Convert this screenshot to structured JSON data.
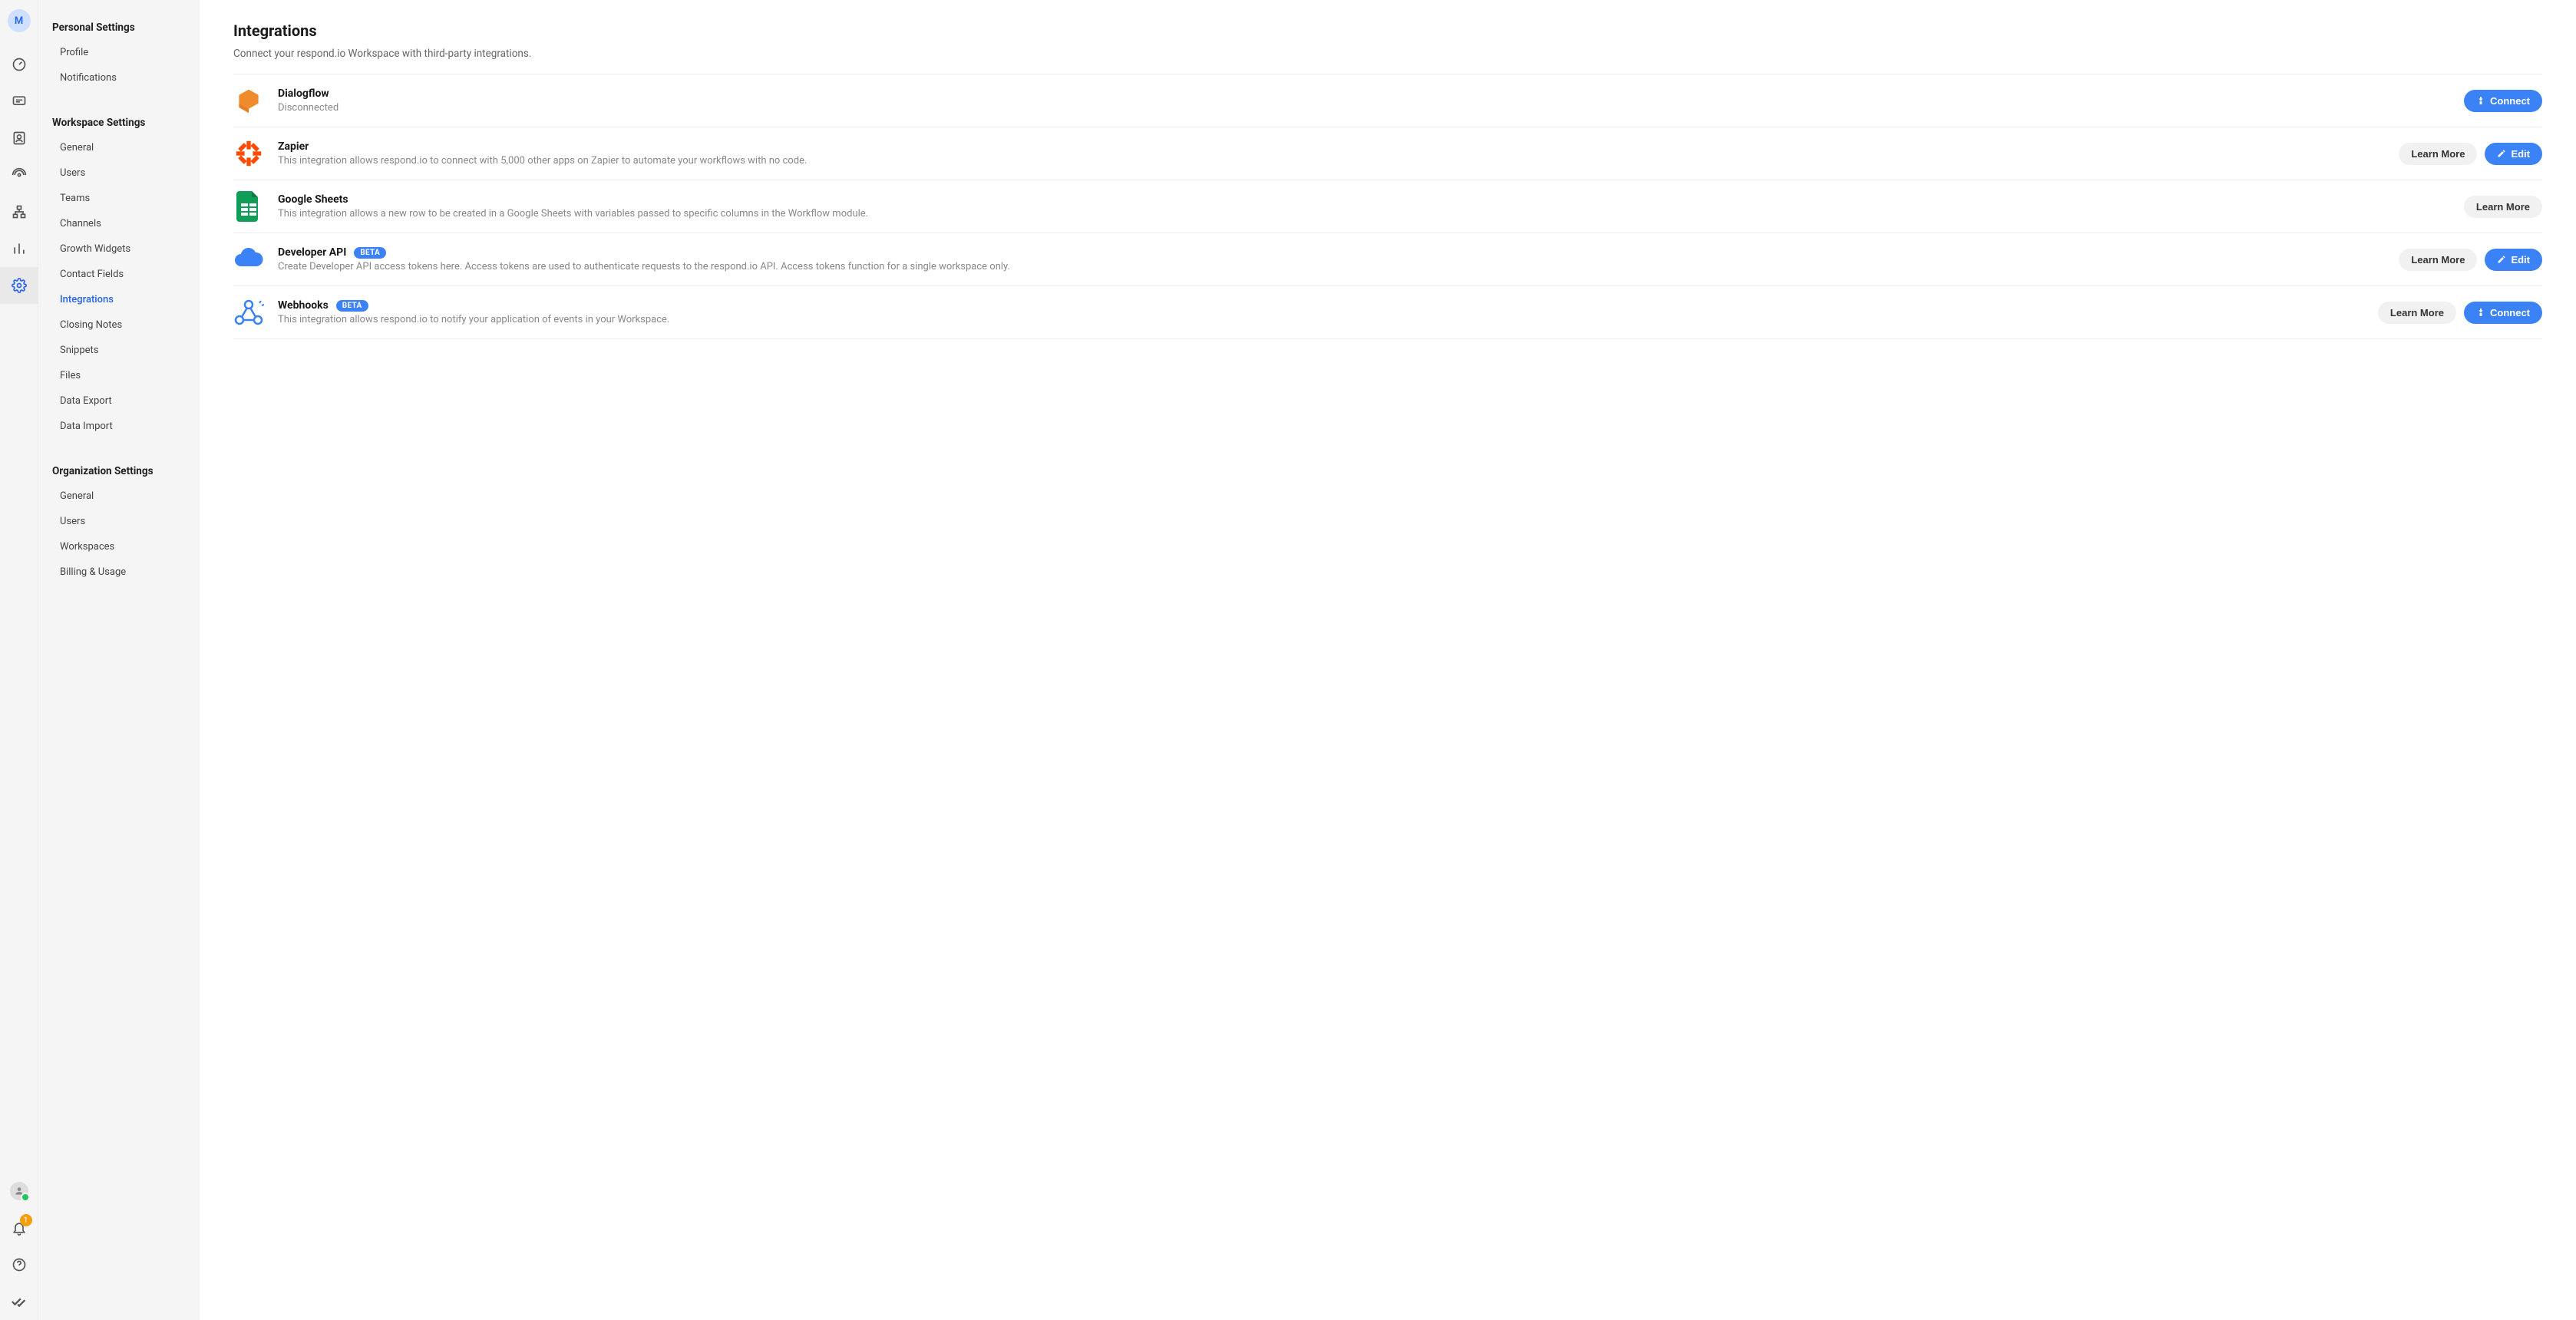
{
  "rail": {
    "avatar_letter": "M",
    "notification_count": "1"
  },
  "sidebar": {
    "personal": {
      "title": "Personal Settings",
      "items": [
        {
          "label": "Profile"
        },
        {
          "label": "Notifications"
        }
      ]
    },
    "workspace": {
      "title": "Workspace Settings",
      "items": [
        {
          "label": "General"
        },
        {
          "label": "Users"
        },
        {
          "label": "Teams"
        },
        {
          "label": "Channels"
        },
        {
          "label": "Growth Widgets"
        },
        {
          "label": "Contact Fields"
        },
        {
          "label": "Integrations",
          "active": true
        },
        {
          "label": "Closing Notes"
        },
        {
          "label": "Snippets"
        },
        {
          "label": "Files"
        },
        {
          "label": "Data Export"
        },
        {
          "label": "Data Import"
        }
      ]
    },
    "organization": {
      "title": "Organization Settings",
      "items": [
        {
          "label": "General"
        },
        {
          "label": "Users"
        },
        {
          "label": "Workspaces"
        },
        {
          "label": "Billing & Usage"
        }
      ]
    }
  },
  "main": {
    "title": "Integrations",
    "subtitle": "Connect your respond.io Workspace with third-party integrations.",
    "buttons": {
      "connect": "Connect",
      "learn_more": "Learn More",
      "edit": "Edit"
    },
    "beta_label": "BETA",
    "integrations": [
      {
        "name": "Dialogflow",
        "sub": "Disconnected"
      },
      {
        "name": "Zapier",
        "sub": "This integration allows respond.io to connect with 5,000 other apps on Zapier to automate your workflows with no code."
      },
      {
        "name": "Google Sheets",
        "sub": "This integration allows a new row to be created in a Google Sheets with variables passed to specific columns in the Workflow module."
      },
      {
        "name": "Developer API",
        "sub": "Create Developer API access tokens here. Access tokens are used to authenticate requests to the respond.io API. Access tokens function for a single workspace only."
      },
      {
        "name": "Webhooks",
        "sub": "This integration allows respond.io to notify your application of events in your Workspace."
      }
    ]
  }
}
